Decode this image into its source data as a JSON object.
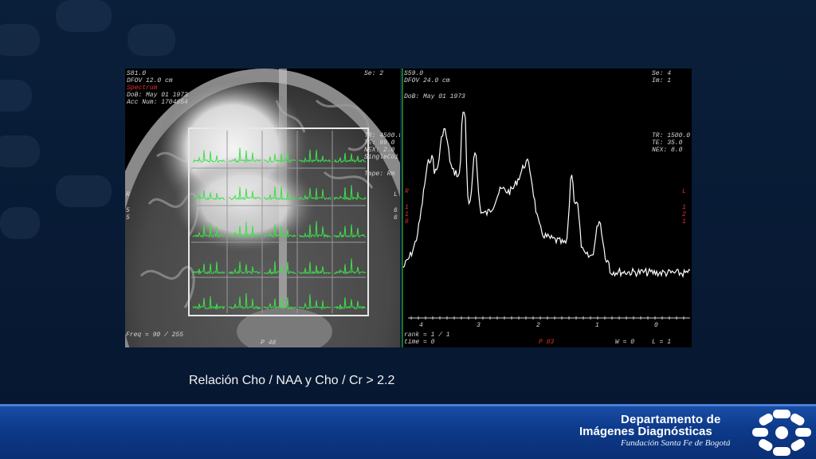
{
  "slide": {
    "caption": "Relación Cho / NAA  y  Cho / Cr > 2.2",
    "footer": {
      "line1": "Departamento de",
      "line2": "Imágenes Diagnósticas",
      "line3": "Fundación Santa Fe de Bogotá",
      "logo_icon": "fundacion-logo-icon"
    }
  },
  "mri_panel": {
    "top_left": [
      "S81.0",
      "DFOV 12.0 cm",
      "Spectrum",
      "DoB: May 01 1973",
      "Acc Num: 1704854"
    ],
    "top_right": "Se: 2",
    "params": [
      "TR: 4500.0",
      "TE: 99.0",
      "NEX: 2.0",
      "SingleCoil",
      "Tape: Rm"
    ],
    "left_side": [
      "R",
      "5",
      "5"
    ],
    "right_side": [
      "L",
      "6",
      "6"
    ],
    "bottom_left": "Freq = 90 / 255",
    "bottom_center": "P 48"
  },
  "spectrum_panel": {
    "top_left": [
      "S59.0",
      "DFOV 24.0 cm",
      "DoB: May 01 1973"
    ],
    "top_right": [
      "Se: 4",
      "Im: 1"
    ],
    "params": [
      "TR: 1500.0",
      "TE: 35.0",
      "NEX: 8.0"
    ],
    "left_side": [
      "R",
      "1",
      "1",
      "8"
    ],
    "right_side": [
      "L",
      "1",
      "2",
      "1"
    ],
    "axis_ticks": [
      "4",
      "3",
      "2",
      "1",
      "0"
    ],
    "bottom_left": [
      "rank = 1 / 1",
      "time = 0"
    ],
    "bottom_center": "P 83",
    "bottom_right": [
      "W = 0",
      "L = 1"
    ]
  }
}
